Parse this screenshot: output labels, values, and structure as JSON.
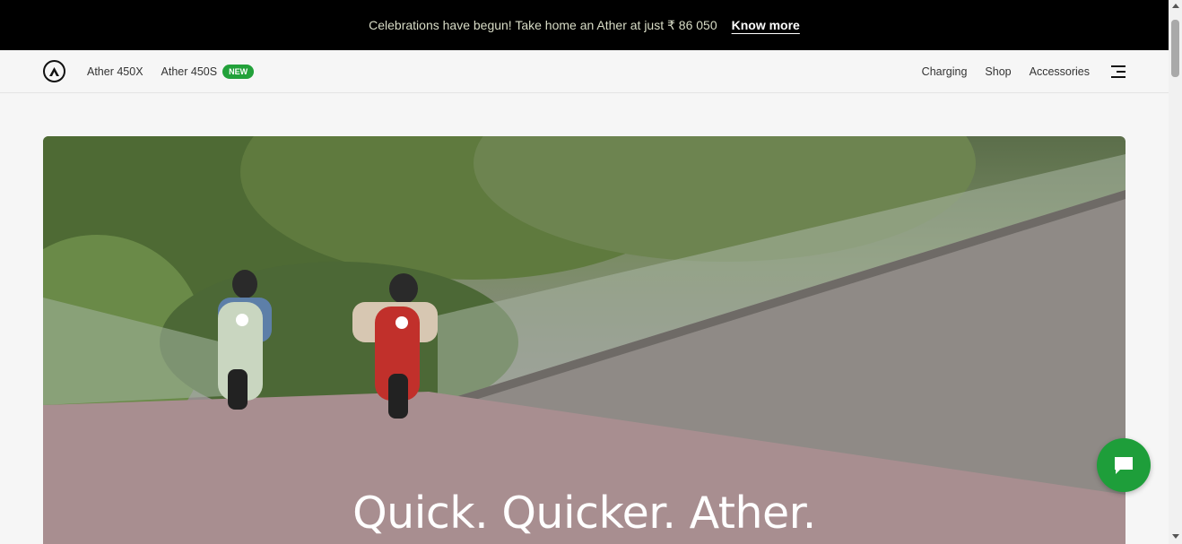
{
  "announcement": {
    "message": "Celebrations have begun! Take home an Ather at just ₹ 86 050",
    "cta_label": "Know more"
  },
  "nav": {
    "logo_icon": "ather-logo-icon",
    "items_left": [
      {
        "label": "Ather 450X"
      },
      {
        "label": "Ather 450S",
        "badge": "NEW"
      }
    ],
    "items_right": [
      {
        "label": "Charging"
      },
      {
        "label": "Shop"
      },
      {
        "label": "Accessories"
      }
    ],
    "menu_icon": "hamburger-menu-icon"
  },
  "hero": {
    "title": "Quick. Quicker. Ather."
  },
  "chat": {
    "icon": "chat-bubble-icon"
  },
  "colors": {
    "badge": "#22a13a",
    "chat": "#1e9e3a",
    "announcement_bg": "#000000"
  }
}
